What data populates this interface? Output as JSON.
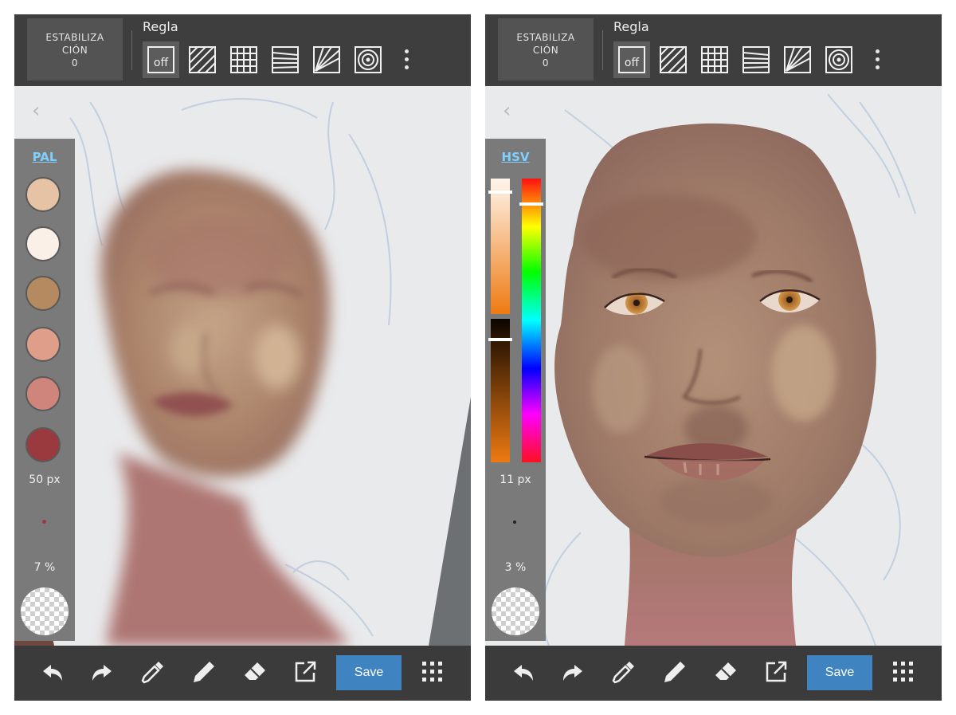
{
  "left": {
    "stabilization": {
      "line1": "ESTABILIZA",
      "line2": "CIÓN",
      "value": "0"
    },
    "ruler": {
      "label": "Regla",
      "off_label": "off"
    },
    "panel": {
      "mode": "PAL",
      "swatches": [
        "#e7c3a5",
        "#fbf0e7",
        "#b68a60",
        "#de9e8a",
        "#cf857b",
        "#9b3a3e"
      ],
      "size": "50 px",
      "opacity": "7 %"
    },
    "save_label": "Save"
  },
  "right": {
    "stabilization": {
      "line1": "ESTABILIZA",
      "line2": "CIÓN",
      "value": "0"
    },
    "ruler": {
      "label": "Regla",
      "off_label": "off"
    },
    "panel": {
      "mode": "HSV",
      "size": "11 px",
      "opacity": "3 %"
    },
    "save_label": "Save"
  }
}
